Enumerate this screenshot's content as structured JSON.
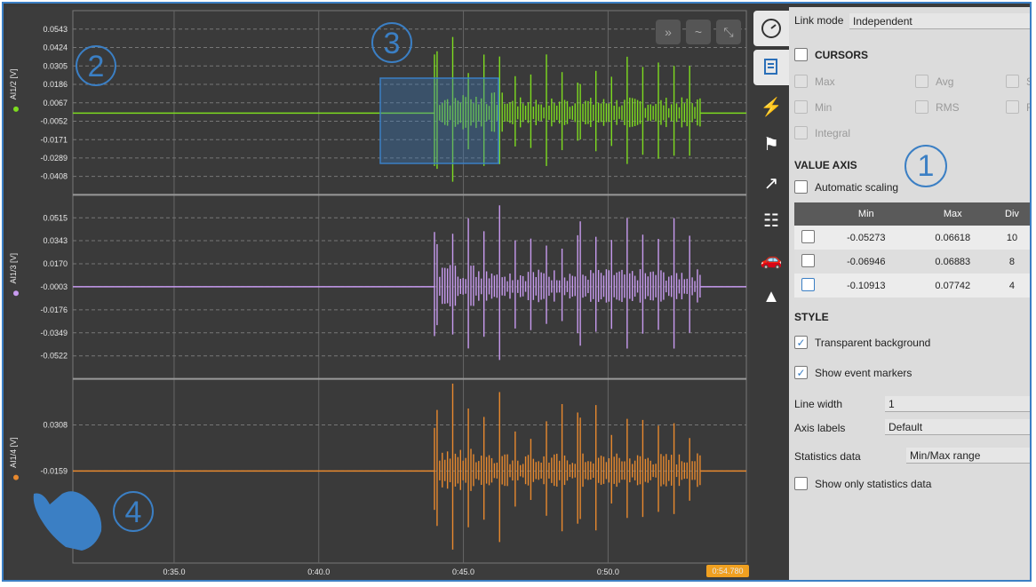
{
  "chart_data": {
    "type": "line",
    "xlim": [
      31.5,
      54.78
    ],
    "x_ticks": [
      "0:35.0",
      "0:40.0",
      "0:45.0",
      "0:50.0"
    ],
    "x_tick_values": [
      35,
      40,
      45,
      50
    ],
    "cursor_label": "0:54.780",
    "series": [
      {
        "name": "AI1/2 [V]",
        "color": "#7ddc1f",
        "yticks": [
          "0.0543",
          "0.0424",
          "0.0305",
          "0.0186",
          "0.0067",
          "-0.0052",
          "-0.0171",
          "-0.0289",
          "-0.0408"
        ],
        "ylim": [
          -0.0527,
          0.0662
        ],
        "baseline": 0.0
      },
      {
        "name": "AI1/3 [V]",
        "color": "#c89bf0",
        "yticks": [
          "0.0515",
          "0.0343",
          "0.0170",
          "-0.0003",
          "-0.0176",
          "-0.0349",
          "-0.0522"
        ],
        "ylim": [
          -0.0695,
          0.0688
        ],
        "baseline": -0.0003
      },
      {
        "name": "AI1/4 [V]",
        "color": "#e8892e",
        "yticks": [
          "0.0308",
          "-0.0159"
        ],
        "ylim": [
          -0.1091,
          0.0774
        ],
        "baseline": -0.0159
      }
    ]
  },
  "annotations": [
    "1",
    "2",
    "3",
    "4"
  ],
  "chart_controls": {
    "next_icon": "double-chevron-right-icon",
    "wave_icon": "wave-icon",
    "collapse_icon": "collapse-icon"
  },
  "tabs": [
    "gauge-icon",
    "cursor-doc-icon",
    "lightning-icon",
    "flag-icon",
    "export-icon",
    "hierarchy-icon",
    "car-icon",
    "triangle-logo-icon"
  ],
  "panel": {
    "link_mode_label": "Link mode",
    "link_mode_value": "Independent",
    "cursors_label": "CURSORS",
    "cursor_opts": {
      "max": "Max",
      "avg": "Avg",
      "s": "S",
      "min": "Min",
      "rms": "RMS",
      "f": "F",
      "integral": "Integral"
    },
    "value_axis_label": "VALUE AXIS",
    "auto_scaling_label": "Automatic scaling",
    "table_headers": {
      "min": "Min",
      "max": "Max",
      "div": "Div"
    },
    "table_rows": [
      {
        "min": "-0.05273",
        "max": "0.06618",
        "div": "10"
      },
      {
        "min": "-0.06946",
        "max": "0.06883",
        "div": "8"
      },
      {
        "min": "-0.10913",
        "max": "0.07742",
        "div": "4"
      }
    ],
    "style_label": "STYLE",
    "transparent_bg_label": "Transparent background",
    "show_event_markers_label": "Show event markers",
    "line_width_label": "Line width",
    "line_width_value": "1",
    "axis_labels_label": "Axis labels",
    "axis_labels_value": "Default",
    "statistics_label": "Statistics data",
    "statistics_value": "Min/Max range",
    "show_only_stats_label": "Show only statistics data"
  }
}
